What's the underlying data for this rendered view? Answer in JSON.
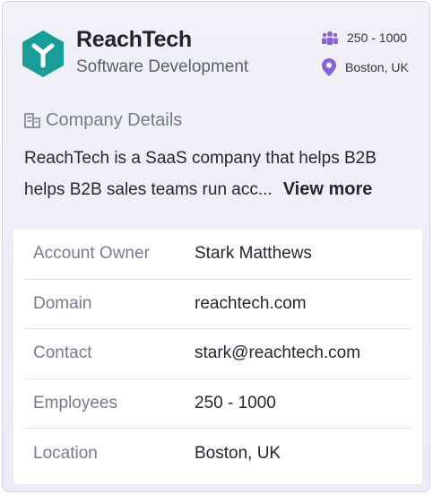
{
  "company": {
    "name": "ReachTech",
    "category": "Software Development",
    "logo_icon": "reachtech-logo-icon",
    "brand_color": "#1a9c98"
  },
  "meta": {
    "employees": "250 - 1000",
    "employees_icon": "people-icon",
    "location": "Boston, UK",
    "location_icon": "location-pin-icon",
    "icon_color": "#8c62d6"
  },
  "details_section": {
    "title": "Company Details",
    "icon": "building-icon",
    "description_line1": "ReachTech is a SaaS company that helps B2B",
    "description_line2": "helps B2B sales teams run acc...",
    "view_more_label": "View more"
  },
  "rows": [
    {
      "label": "Account Owner",
      "value": "Stark Matthews"
    },
    {
      "label": "Domain",
      "value": "reachtech.com"
    },
    {
      "label": "Contact",
      "value": "stark@reachtech.com"
    },
    {
      "label": "Employees",
      "value": "250 - 1000"
    },
    {
      "label": "Location",
      "value": "Boston, UK"
    }
  ]
}
